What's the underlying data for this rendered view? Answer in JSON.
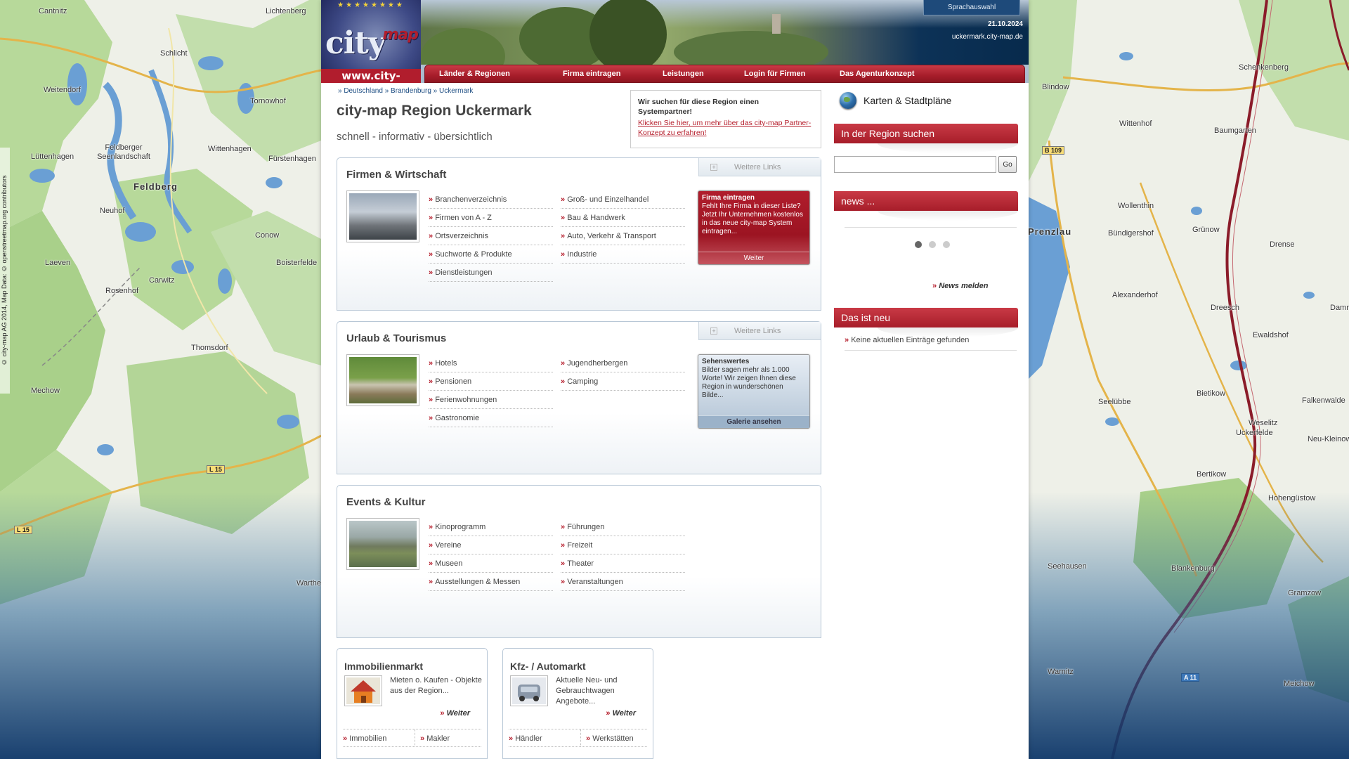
{
  "map": {
    "attribution": "© city-map AG 2014, Map Data: © openstreetmap.org contributors",
    "left_places": [
      "Cantnitz",
      "Lichtenberg",
      "Schlicht",
      "Weitendorf",
      "Tornowhof",
      "Feldberger Seenlandschaft",
      "Wittenhagen",
      "Lüttenhagen",
      "Fürstenhagen",
      "Feldberg",
      "Neuhof",
      "Conow",
      "Laeven",
      "Boisterfelde",
      "Carwitz",
      "Rosenhof",
      "Thomsdorf",
      "Mechow",
      "Warthe"
    ],
    "right_places": [
      "Schenkenberg",
      "Blindow",
      "Wittenhof",
      "Baumgarten",
      "Wollenthin",
      "Prenzlau",
      "Bündigershof",
      "Grünow",
      "Drense",
      "Alexanderhof",
      "Dreesch",
      "Damme",
      "Ewaldshof",
      "Bietikow",
      "Seelübbe",
      "Falkenwalde",
      "Weselitz",
      "Uckerfelde",
      "Neu-Kleinow",
      "Bertikow",
      "Hohengüstow",
      "Seehausen",
      "Blankenburg",
      "Gramzow",
      "Warnitz",
      "Meichow"
    ],
    "road_tags_left": [
      "L 15",
      "L 15"
    ],
    "road_tags_right": [
      "B 109",
      "A 11"
    ]
  },
  "header": {
    "logo_word": "city",
    "logo_word2": "map",
    "logo_url": "www.city-map.de",
    "language_tab": "Sprachauswahl",
    "date": "21.10.2024",
    "domain": "uckermark.city-map.de"
  },
  "nav": {
    "items": [
      "Länder & Regionen",
      "Firma eintragen",
      "Leistungen",
      "Login für Firmen",
      "Das Agenturkonzept"
    ]
  },
  "breadcrumb": {
    "items": [
      "» Deutschland",
      "» Brandenburg",
      "» Uckermark"
    ]
  },
  "page": {
    "title": "city-map Region Uckermark",
    "slogan": "schnell - informativ - übersichtlich"
  },
  "partner": {
    "text": "Wir suchen für diese Region einen Systempartner!",
    "link": "Klicken Sie hier, um mehr über das city-map Partner-Konzept zu erfahren!"
  },
  "sections": [
    {
      "title": "Firmen & Wirtschaft",
      "more": "Weitere Links",
      "col1": [
        "Branchenverzeichnis",
        "Firmen von A - Z",
        "Ortsverzeichnis",
        "Suchworte & Produkte",
        "Dienstleistungen"
      ],
      "col2": [
        "Groß- und Einzelhandel",
        "Bau & Handwerk",
        "Auto, Verkehr & Transport",
        "Industrie"
      ],
      "promo_title": "Firma eintragen",
      "promo_text": "Fehlt Ihre Firma in dieser Liste? Jetzt Ihr Unternehmen kostenlos in das neue city-map System eintragen...",
      "promo_button": "Weiter"
    },
    {
      "title": "Urlaub & Tourismus",
      "more": "Weitere Links",
      "col1": [
        "Hotels",
        "Pensionen",
        "Ferienwohnungen",
        "Gastronomie"
      ],
      "col2": [
        "Jugendherbergen",
        "Camping"
      ],
      "promo_title": "Sehenswertes",
      "promo_text": "Bilder sagen mehr als 1.000 Worte! Wir zeigen Ihnen diese Region in wunderschönen Bilde...",
      "promo_button": "Galerie ansehen"
    },
    {
      "title": "Events & Kultur",
      "col1": [
        "Kinoprogramm",
        "Vereine",
        "Museen",
        "Ausstellungen & Messen"
      ],
      "col2": [
        "Führungen",
        "Freizeit",
        "Theater",
        "Veranstaltungen"
      ]
    }
  ],
  "boxes": [
    {
      "title": "Immobilienmarkt",
      "desc": "Mieten o. Kaufen - Objekte aus der Region...",
      "weiter": "Weiter",
      "link1": "Immobilien",
      "link2": "Makler"
    },
    {
      "title": "Kfz- / Automarkt",
      "desc": "Aktuelle Neu- und Gebrauchtwagen Angebote...",
      "weiter": "Weiter",
      "link1": "Händler",
      "link2": "Werkstätten"
    }
  ],
  "sidebar": {
    "maps_label": "Karten & Stadtpläne",
    "search_head": "In der Region suchen",
    "search_button": "Go",
    "news_head": "news ...",
    "news_link": "News melden",
    "new_head": "Das ist neu",
    "new_item": "Keine aktuellen Einträge gefunden"
  },
  "colors": {
    "accent_red": "#a71d2a",
    "nav_blue": "#1e4a7a"
  }
}
